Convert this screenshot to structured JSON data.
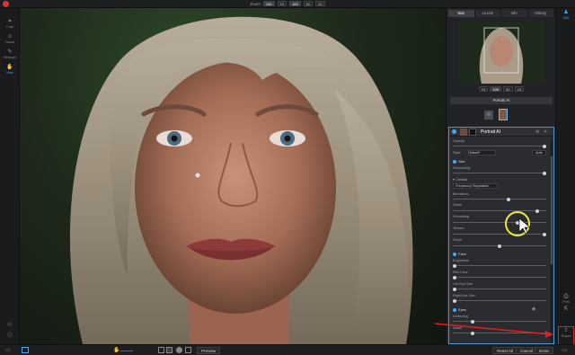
{
  "topbar": {
    "zoom_label": "Zoom",
    "zoom_value": "100",
    "zoom_options": [
      "Fit",
      "100",
      "50",
      "25"
    ]
  },
  "left_tools": [
    {
      "label": "Crop",
      "icon": "crop-icon"
    },
    {
      "label": "Faces",
      "icon": "faces-icon"
    },
    {
      "label": "Retouch",
      "icon": "retouch-icon"
    },
    {
      "label": "View",
      "icon": "view-icon"
    }
  ],
  "right_tabs": [
    "Nav",
    "Levels",
    "Info",
    "History"
  ],
  "nav": {
    "zoom_options": [
      "Fit",
      "100",
      "50",
      "25"
    ],
    "portrait_ai_button": "Portrait AI"
  },
  "portrait_ai": {
    "title": "Portrait AI",
    "opacity_label": "Opacity",
    "style_label": "Style",
    "style_value": "Default*",
    "auto_label": "Auto",
    "skin_label": "Skin",
    "retouching_label": "Retouching",
    "details_label": "Details",
    "method_value": "Frequency Separation",
    "blemishes_label": "Blemishes",
    "detail_label": "Detail",
    "smoothing_label": "Smoothing",
    "texture_label": "Texture",
    "shine_label": "Shine",
    "face_label": "Face",
    "brightness_label": "Brightness",
    "slim_face_label": "Slim Face",
    "left_eye_size_label": "Left Eye Size",
    "right_eye_size_label": "Right Eye Size",
    "eyes_label": "Eyes",
    "whitening_label": "Whitening",
    "detail2_label": "Detail"
  },
  "right_strip": [
    {
      "label": "Edit",
      "icon": "edit-icon"
    },
    {
      "label": "Print",
      "icon": "print-icon"
    },
    {
      "label": "Export",
      "icon": "export-icon"
    }
  ],
  "bottombar": {
    "preview_label": "Preview",
    "reset_all": "Reset All",
    "cancel": "Cancel",
    "done": "Done"
  },
  "colors": {
    "accent": "#3fa9f5",
    "annotation_red": "#e02020",
    "cursor_highlight": "#f6ea3a"
  }
}
